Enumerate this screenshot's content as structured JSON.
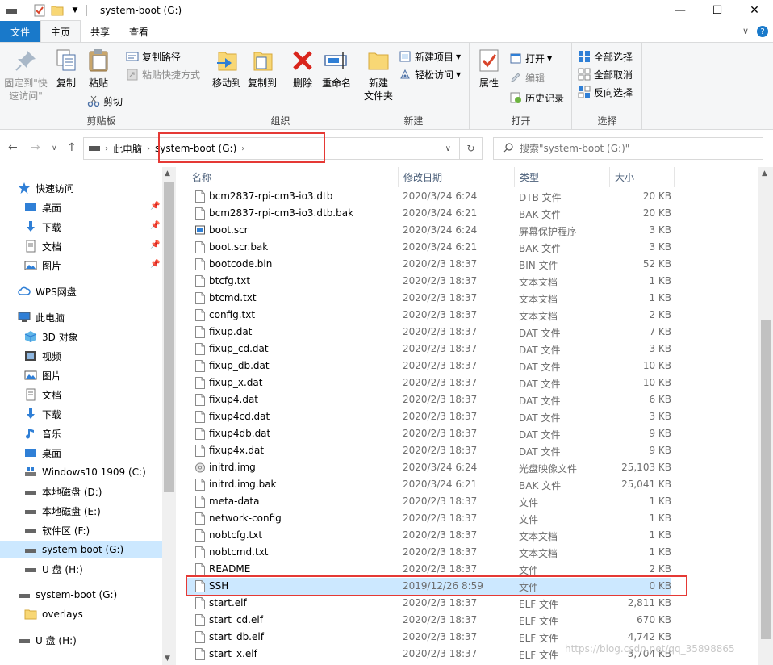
{
  "window": {
    "title": "system-boot (G:)",
    "controls": {
      "minimize": "—",
      "maximize": "☐",
      "close": "✕"
    }
  },
  "ribbon_tabs": [
    {
      "label": "文件"
    },
    {
      "label": "主页"
    },
    {
      "label": "共享"
    },
    {
      "label": "查看"
    }
  ],
  "ribbon": {
    "clipboard": {
      "label": "剪贴板",
      "pin": "固定到\"快\n速访问\"",
      "copy": "复制",
      "paste": "粘贴",
      "copy_path": "复制路径",
      "paste_shortcut": "粘贴快捷方式",
      "cut": "剪切"
    },
    "organize": {
      "label": "组织",
      "move_to": "移动到",
      "copy_to": "复制到",
      "delete": "删除",
      "rename": "重命名"
    },
    "new": {
      "label": "新建",
      "new_folder": "新建\n文件夹",
      "new_item": "新建项目",
      "easy_access": "轻松访问"
    },
    "open": {
      "label": "打开",
      "properties": "属性",
      "open": "打开",
      "edit": "编辑",
      "history": "历史记录"
    },
    "select": {
      "label": "选择",
      "select_all": "全部选择",
      "select_none": "全部取消",
      "invert": "反向选择"
    }
  },
  "address": {
    "segments": [
      "此电脑",
      "system-boot (G:)"
    ],
    "search_placeholder": "搜索\"system-boot (G:)\""
  },
  "nav": {
    "quick_access": "快速访问",
    "quick_items": [
      "桌面",
      "下载",
      "文档",
      "图片"
    ],
    "wps": "WPS网盘",
    "this_pc": "此电脑",
    "pc_items": [
      "3D 对象",
      "视频",
      "图片",
      "文档",
      "下载",
      "音乐",
      "桌面"
    ],
    "drives": [
      "Windows10 1909 (C:)",
      "本地磁盘 (D:)",
      "本地磁盘 (E:)",
      "软件区 (F:)",
      "system-boot (G:)",
      "U 盘 (H:)"
    ],
    "boot_drive": "system-boot (G:)",
    "overlays": "overlays",
    "usb": "U 盘 (H:)"
  },
  "columns": {
    "name": "名称",
    "date": "修改日期",
    "type": "类型",
    "size": "大小"
  },
  "files": [
    {
      "name": "bcm2837-rpi-cm3-io3.dtb",
      "date": "2020/3/24 6:24",
      "type": "DTB 文件",
      "size": "20 KB"
    },
    {
      "name": "bcm2837-rpi-cm3-io3.dtb.bak",
      "date": "2020/3/24 6:21",
      "type": "BAK 文件",
      "size": "20 KB"
    },
    {
      "name": "boot.scr",
      "date": "2020/3/24 6:24",
      "type": "屏幕保护程序",
      "size": "3 KB"
    },
    {
      "name": "boot.scr.bak",
      "date": "2020/3/24 6:21",
      "type": "BAK 文件",
      "size": "3 KB"
    },
    {
      "name": "bootcode.bin",
      "date": "2020/2/3 18:37",
      "type": "BIN 文件",
      "size": "52 KB"
    },
    {
      "name": "btcfg.txt",
      "date": "2020/2/3 18:37",
      "type": "文本文档",
      "size": "1 KB"
    },
    {
      "name": "btcmd.txt",
      "date": "2020/2/3 18:37",
      "type": "文本文档",
      "size": "1 KB"
    },
    {
      "name": "config.txt",
      "date": "2020/2/3 18:37",
      "type": "文本文档",
      "size": "2 KB"
    },
    {
      "name": "fixup.dat",
      "date": "2020/2/3 18:37",
      "type": "DAT 文件",
      "size": "7 KB"
    },
    {
      "name": "fixup_cd.dat",
      "date": "2020/2/3 18:37",
      "type": "DAT 文件",
      "size": "3 KB"
    },
    {
      "name": "fixup_db.dat",
      "date": "2020/2/3 18:37",
      "type": "DAT 文件",
      "size": "10 KB"
    },
    {
      "name": "fixup_x.dat",
      "date": "2020/2/3 18:37",
      "type": "DAT 文件",
      "size": "10 KB"
    },
    {
      "name": "fixup4.dat",
      "date": "2020/2/3 18:37",
      "type": "DAT 文件",
      "size": "6 KB"
    },
    {
      "name": "fixup4cd.dat",
      "date": "2020/2/3 18:37",
      "type": "DAT 文件",
      "size": "3 KB"
    },
    {
      "name": "fixup4db.dat",
      "date": "2020/2/3 18:37",
      "type": "DAT 文件",
      "size": "9 KB"
    },
    {
      "name": "fixup4x.dat",
      "date": "2020/2/3 18:37",
      "type": "DAT 文件",
      "size": "9 KB"
    },
    {
      "name": "initrd.img",
      "date": "2020/3/24 6:24",
      "type": "光盘映像文件",
      "size": "25,103 KB"
    },
    {
      "name": "initrd.img.bak",
      "date": "2020/3/24 6:21",
      "type": "BAK 文件",
      "size": "25,041 KB"
    },
    {
      "name": "meta-data",
      "date": "2020/2/3 18:37",
      "type": "文件",
      "size": "1 KB"
    },
    {
      "name": "network-config",
      "date": "2020/2/3 18:37",
      "type": "文件",
      "size": "1 KB"
    },
    {
      "name": "nobtcfg.txt",
      "date": "2020/2/3 18:37",
      "type": "文本文档",
      "size": "1 KB"
    },
    {
      "name": "nobtcmd.txt",
      "date": "2020/2/3 18:37",
      "type": "文本文档",
      "size": "1 KB"
    },
    {
      "name": "README",
      "date": "2020/2/3 18:37",
      "type": "文件",
      "size": "2 KB"
    },
    {
      "name": "SSH",
      "date": "2019/12/26 8:59",
      "type": "文件",
      "size": "0 KB"
    },
    {
      "name": "start.elf",
      "date": "2020/2/3 18:37",
      "type": "ELF 文件",
      "size": "2,811 KB"
    },
    {
      "name": "start_cd.elf",
      "date": "2020/2/3 18:37",
      "type": "ELF 文件",
      "size": "670 KB"
    },
    {
      "name": "start_db.elf",
      "date": "2020/2/3 18:37",
      "type": "ELF 文件",
      "size": "4,742 KB"
    },
    {
      "name": "start_x.elf",
      "date": "2020/2/3 18:37",
      "type": "ELF 文件",
      "size": "3,704 KB"
    }
  ],
  "selected_file_index": 23,
  "watermark": "https://blog.csdn.net/qq_35898865",
  "colors": {
    "accent": "#1979ca",
    "selection": "#cce8ff",
    "highlight_box": "#e53935"
  }
}
